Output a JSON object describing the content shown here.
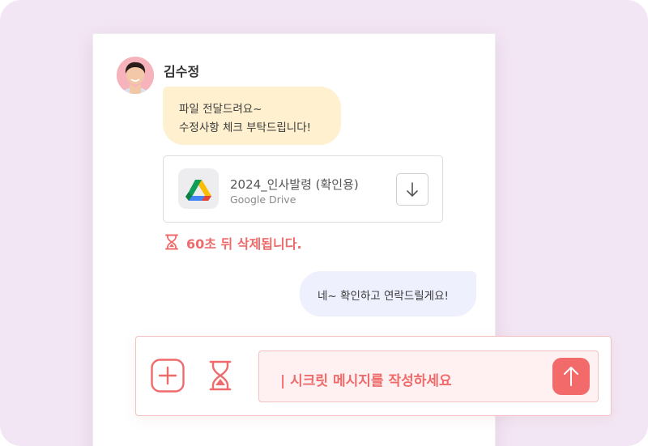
{
  "chat": {
    "sender_name": "김수정",
    "incoming_message": [
      "파일 전달드려요~",
      "수정사항 체크 부탁드립니다!"
    ],
    "attachment": {
      "file_name": "2024_인사발령 (확인용)",
      "source": "Google Drive",
      "icon": "google-drive-icon",
      "download_icon": "download-arrow-icon"
    },
    "expiry_notice": "60초 뒤 삭제됩니다.",
    "outgoing_message": "네~ 확인하고 연락드릴게요!"
  },
  "composer": {
    "placeholder": "| 시크릿 메시지를 작성하세요",
    "add_icon": "plus-icon",
    "timer_icon": "hourglass-icon",
    "send_icon": "arrow-up-icon"
  },
  "colors": {
    "accent": "#ef6b6b",
    "incoming_bubble": "#fff0cf",
    "outgoing_bubble": "#eef0fd",
    "background": "#f3e6f4"
  }
}
